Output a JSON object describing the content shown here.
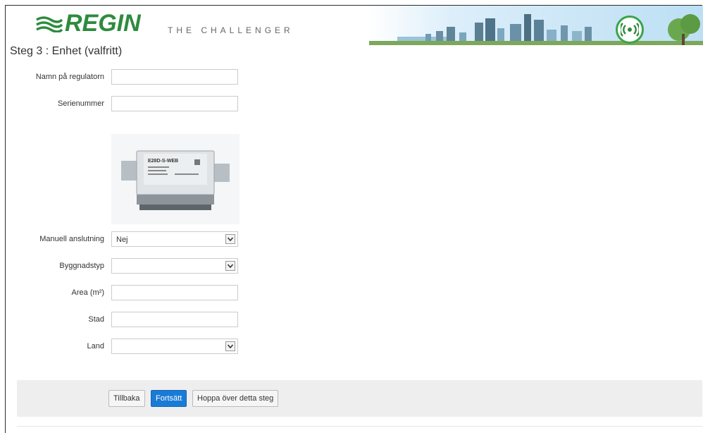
{
  "header": {
    "brand": "REGIN",
    "tagline": "THE CHALLENGER"
  },
  "page": {
    "title": "Steg 3 : Enhet (valfritt)"
  },
  "form": {
    "controller_name": {
      "label": "Namn på regulatorn",
      "value": ""
    },
    "serial_number": {
      "label": "Serienummer",
      "value": ""
    },
    "device_image": {
      "model_text": "E28D-S-WEB"
    },
    "manual_connection": {
      "label": "Manuell anslutning",
      "value": "Nej"
    },
    "building_type": {
      "label": "Byggnadstyp",
      "value": ""
    },
    "area": {
      "label": "Area (m²)",
      "value": ""
    },
    "city": {
      "label": "Stad",
      "value": ""
    },
    "country": {
      "label": "Land",
      "value": ""
    }
  },
  "buttons": {
    "back": "Tillbaka",
    "continue": "Fortsätt",
    "skip": "Hoppa över detta steg"
  },
  "colors": {
    "brand_green": "#2e8b3e",
    "primary_button": "#1a7bd6",
    "footer_bg": "#eeeeee"
  }
}
